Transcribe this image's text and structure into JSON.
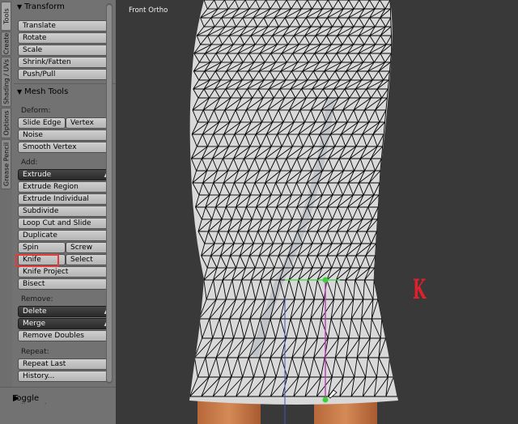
{
  "tabs": [
    "Tools",
    "Create",
    "Shading / UVs",
    "Options",
    "Grease Pencil"
  ],
  "transform": {
    "header": "Transform",
    "buttons": [
      "Translate",
      "Rotate",
      "Scale",
      "Shrink/Fatten",
      "Push/Pull"
    ]
  },
  "mesh_tools": {
    "header": "Mesh Tools",
    "deform_label": "Deform:",
    "slide_edge": "Slide Edge",
    "vertex": "Vertex",
    "noise": "Noise",
    "smooth_vertex": "Smooth Vertex",
    "add_label": "Add:",
    "extrude": "Extrude",
    "extrude_region": "Extrude Region",
    "extrude_individual": "Extrude Individual",
    "subdivide": "Subdivide",
    "loop_cut": "Loop Cut and Slide",
    "duplicate": "Duplicate",
    "spin": "Spin",
    "screw": "Screw",
    "knife": "Knife",
    "select": "Select",
    "knife_project": "Knife Project",
    "bisect": "Bisect",
    "remove_label": "Remove:",
    "delete": "Delete",
    "merge": "Merge",
    "remove_doubles": "Remove Doubles",
    "repeat_label": "Repeat:",
    "repeat_last": "Repeat Last",
    "history": "History..."
  },
  "toggle_editmode": "Toggle Editmode",
  "viewport": {
    "label": "Front Ortho",
    "annotation": "K",
    "annotation_color": "#e0202a"
  },
  "colors": {
    "panel": "#727272",
    "viewport": "#393939",
    "mesh": "#d8d8d8",
    "wire": "#000000",
    "vertex_selected": "#3ad13a",
    "knife_line": "#b43cb4",
    "highlight": "#e23b3b"
  }
}
